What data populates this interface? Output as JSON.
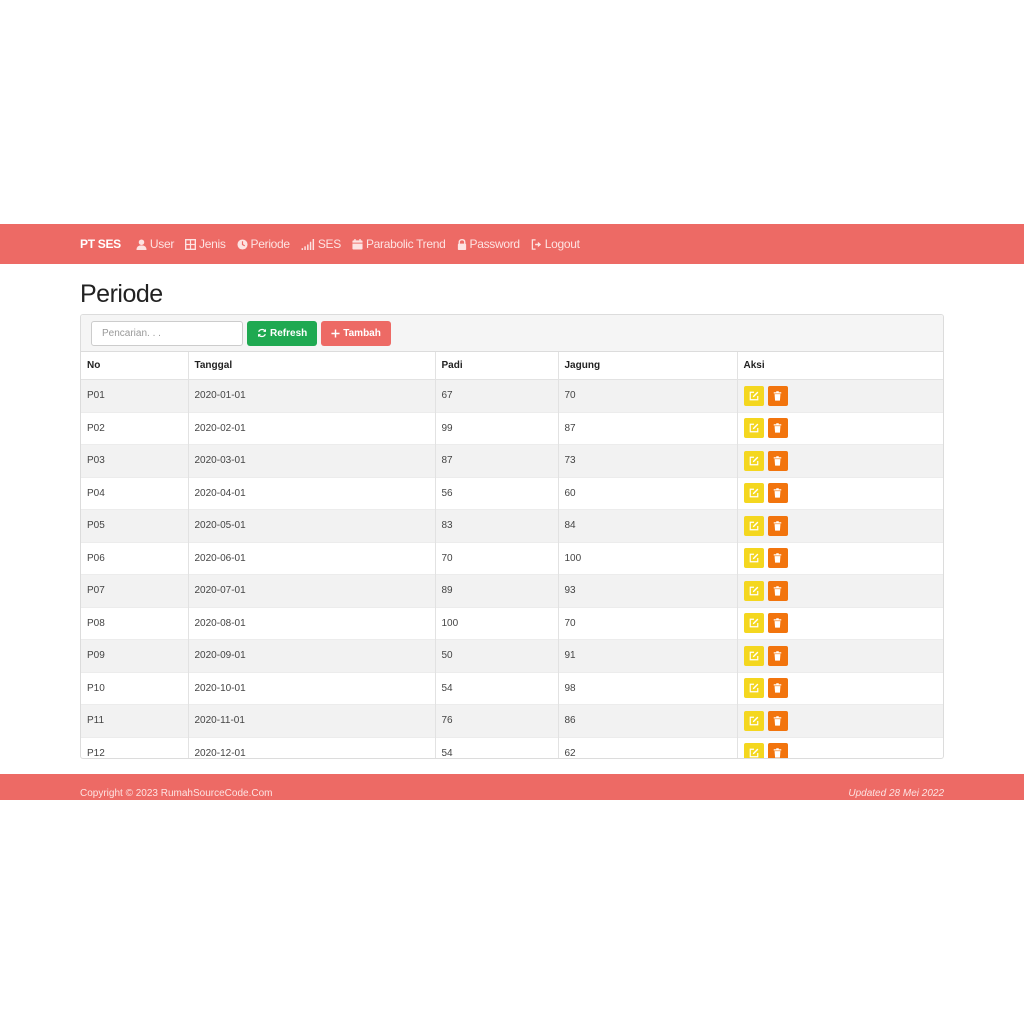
{
  "navbar": {
    "brand": "PT SES",
    "items": [
      {
        "label": "User",
        "icon": "user-icon"
      },
      {
        "label": "Jenis",
        "icon": "table-icon"
      },
      {
        "label": "Periode",
        "icon": "clock-icon"
      },
      {
        "label": "SES",
        "icon": "signal-icon"
      },
      {
        "label": "Parabolic Trend",
        "icon": "calendar-icon"
      },
      {
        "label": "Password",
        "icon": "lock-icon"
      },
      {
        "label": "Logout",
        "icon": "logout-icon"
      }
    ]
  },
  "page": {
    "title": "Periode"
  },
  "toolbar": {
    "search_placeholder": "Pencarian. . .",
    "refresh_label": "Refresh",
    "tambah_label": "Tambah"
  },
  "table": {
    "headers": [
      "No",
      "Tanggal",
      "Padi",
      "Jagung",
      "Aksi"
    ],
    "rows": [
      {
        "no": "P01",
        "tanggal": "2020-01-01",
        "padi": "67",
        "jagung": "70"
      },
      {
        "no": "P02",
        "tanggal": "2020-02-01",
        "padi": "99",
        "jagung": "87"
      },
      {
        "no": "P03",
        "tanggal": "2020-03-01",
        "padi": "87",
        "jagung": "73"
      },
      {
        "no": "P04",
        "tanggal": "2020-04-01",
        "padi": "56",
        "jagung": "60"
      },
      {
        "no": "P05",
        "tanggal": "2020-05-01",
        "padi": "83",
        "jagung": "84"
      },
      {
        "no": "P06",
        "tanggal": "2020-06-01",
        "padi": "70",
        "jagung": "100"
      },
      {
        "no": "P07",
        "tanggal": "2020-07-01",
        "padi": "89",
        "jagung": "93"
      },
      {
        "no": "P08",
        "tanggal": "2020-08-01",
        "padi": "100",
        "jagung": "70"
      },
      {
        "no": "P09",
        "tanggal": "2020-09-01",
        "padi": "50",
        "jagung": "91"
      },
      {
        "no": "P10",
        "tanggal": "2020-10-01",
        "padi": "54",
        "jagung": "98"
      },
      {
        "no": "P11",
        "tanggal": "2020-11-01",
        "padi": "76",
        "jagung": "86"
      },
      {
        "no": "P12",
        "tanggal": "2020-12-01",
        "padi": "54",
        "jagung": "62"
      }
    ]
  },
  "footer": {
    "copyright": "Copyright © 2023 RumahSourceCode.Com",
    "updated": "Updated 28 Mei 2022"
  },
  "colors": {
    "brand": "#ed6a65",
    "refresh": "#1fa951",
    "edit": "#f4d71f",
    "delete": "#f2740d"
  }
}
